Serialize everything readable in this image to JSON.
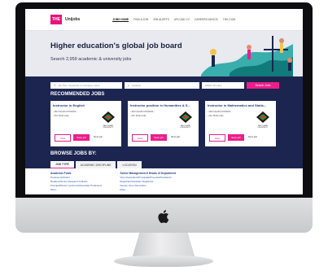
{
  "header": {
    "logo_mark": "THE",
    "logo_text": "Unijobs",
    "nav": [
      "JOBS HOME",
      "FIND A JOB",
      "JOB ALERTS",
      "UPLOAD CV",
      "CAREERS ADVICE",
      "THE.COM"
    ]
  },
  "hero": {
    "title": "Higher education's global job board",
    "subtitle": "Search 2,959 academic & university jobs"
  },
  "search": {
    "keyword_placeholder": "Job Title, Keywords or Company name",
    "location_placeholder": "Location",
    "radius": "Within 20 miles",
    "button": "Search Jobs"
  },
  "recommended": {
    "title": "RECOMMENDED JOBS",
    "cards": [
      {
        "title": "Instructor in English",
        "employer": "ABU DHABI UNIVERSI...",
        "location": "Abu Dhabi (AE)",
        "university": "ABU DHABI UNIVERSITY",
        "view": "View",
        "save": "Save job",
        "next": "Next job"
      },
      {
        "title": "Instructor position in Humanities & S...",
        "employer": "ABU DHABI UNIVERSI...",
        "location": "Abu Dhabi (AE)",
        "university": "ABU DHABI UNIVERSITY",
        "view": "View",
        "save": "Save job",
        "next": "Next job"
      },
      {
        "title": "Instructor in Mathematics and Statis...",
        "employer": "ABU DHABI UNIVERSI...",
        "location": "Abu Dhabi (AE)",
        "university": "ABU DHABI UNIVERSITY",
        "view": "View",
        "save": "Save job",
        "next": "Next job"
      }
    ]
  },
  "browse": {
    "title": "BROWSE JOBS BY:",
    "tabs": [
      "JOB TYPE",
      "ACADEMIC DISCIPLINE",
      "LOCATION"
    ],
    "col1": {
      "heading": "Academic Posts",
      "items": [
        "Professors/Chairs",
        "Readers/Senior Research Fellows",
        "Principal/Senior Lecturers/Associate Professors",
        "More..."
      ]
    },
    "col2": {
      "heading": "Senior Management & Heads of Department",
      "items": [
        "Vice-chancellors/Principals/Provosts/Presidents",
        "Registrars/Assistant Registrars",
        "Deputy Vice-chancellors",
        "More..."
      ]
    }
  },
  "colors": {
    "navy": "#1b2550",
    "accent": "#ec1f8a"
  },
  "device": {
    "logo_icon": "apple-logo-icon"
  }
}
